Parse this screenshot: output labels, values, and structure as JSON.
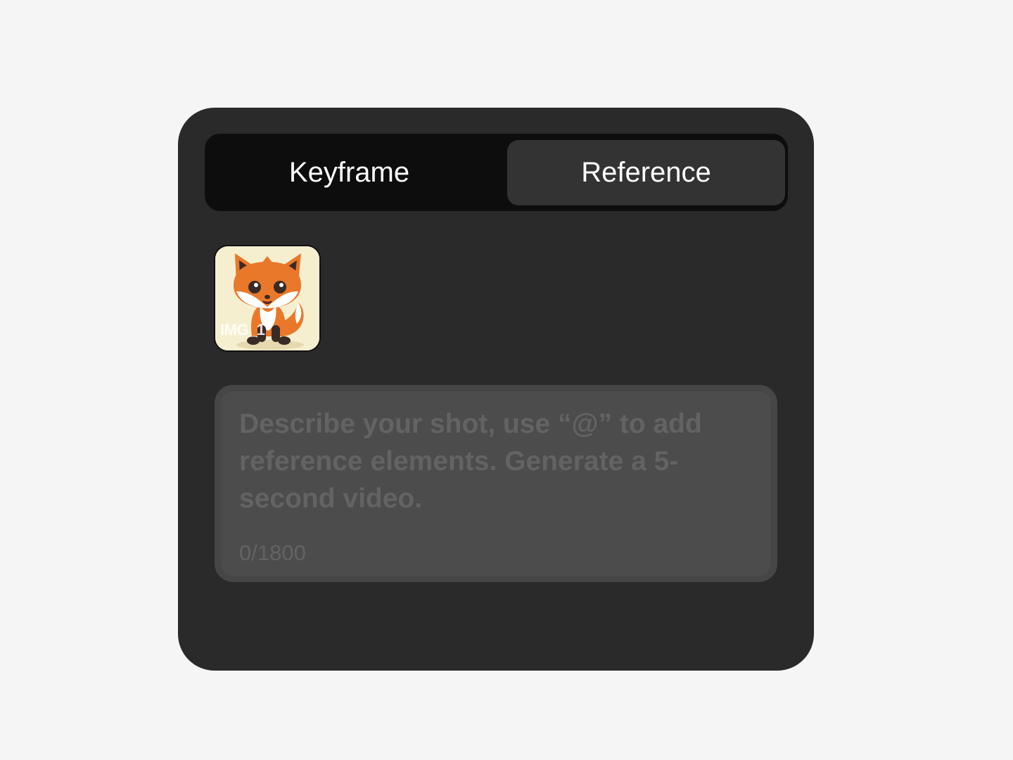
{
  "tabs": [
    {
      "label": "Keyframe",
      "selected": false
    },
    {
      "label": "Reference",
      "selected": true
    }
  ],
  "references": [
    {
      "label": "IMG_1",
      "icon": "fox-illustration"
    }
  ],
  "prompt": {
    "placeholder": "Describe your shot, use “@” to add reference elements. Generate a 5-second video.",
    "counter": "0/1800"
  },
  "colors": {
    "page_background": "#f5f5f5",
    "panel_background": "#2a2a2a",
    "tab_track": "#0d0d0d",
    "tab_selected": "#333333",
    "prompt_background": "#4c4c4c",
    "placeholder_text": "#636363"
  }
}
